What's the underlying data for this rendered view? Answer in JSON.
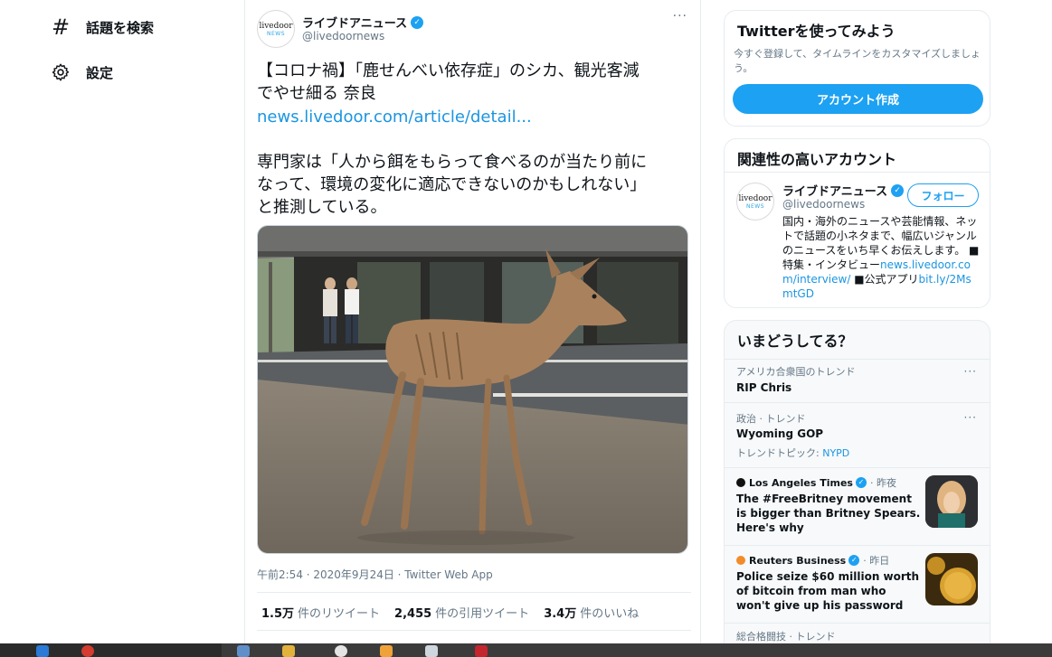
{
  "nav": {
    "explore_label": "話題を検索",
    "settings_label": "設定"
  },
  "tweet": {
    "author_name": "ライブドアニュース",
    "author_handle": "@livedoornews",
    "logo_text_top": "livedoor",
    "logo_text_bottom": "NEWS",
    "text1": "【コロナ禍】「鹿せんべい依存症」のシカ、観光客減\nでやせ細る 奈良",
    "link": "news.livedoor.com/article/detail...",
    "text2": "専門家は「人から餌をもらって食べるのが当たり前に\nなって、環境の変化に適応できないのかもしれない」\nと推測している。",
    "meta": "午前2:54 · 2020年9月24日 · Twitter Web App",
    "retweets_count": "1.5万",
    "retweets_label": "件のリツイート",
    "quotes_count": "2,455",
    "quotes_label": "件の引用ツイート",
    "likes_count": "3.4万",
    "likes_label": "件のいいね"
  },
  "signup": {
    "title": "Twitterを使ってみよう",
    "desc": "今すぐ登録して、タイムラインをカスタマイズしましょう。",
    "button": "アカウント作成"
  },
  "related": {
    "title": "関連性の高いアカウント",
    "name": "ライブドアニュース",
    "handle": "@livedoornews",
    "follow": "フォロー",
    "bio_text": "国内・海外のニュースや芸能情報、ネットで話題の小ネタまで、幅広いジャンルのニュースをいち早くお伝えします。 ■特集・インタビュー",
    "bio_link1": "news.livedoor.com/interview/",
    "bio_mid": " ■公式アプリ",
    "bio_link2": "bit.ly/2MsmtGD"
  },
  "trends": {
    "title": "いまどうしてる？",
    "items": [
      {
        "category": "アメリカ合衆国のトレンド",
        "title": "RIP Chris"
      },
      {
        "category": "政治 · トレンド",
        "title": "Wyoming GOP",
        "sub_label": "トレンドトピック:",
        "sub_link": "NYPD"
      },
      {
        "source": "Los Angeles Times",
        "time": "· 昨夜",
        "title": "The #FreeBritney movement is bigger than Britney Spears. Here's why"
      },
      {
        "source": "Reuters Business",
        "time": "· 昨日",
        "title": "Police seize $60 million worth of bitcoin from man who won't give up his password"
      },
      {
        "category": "総合格闘技 · トレンド"
      }
    ]
  },
  "colors": {
    "accent": "#1da1f2",
    "link": "#1b95e0",
    "border": "#e6ecf0",
    "muted": "#657786"
  },
  "icons": {
    "explore": "hash-icon",
    "settings": "gear-icon",
    "verified": "verified-badge-icon",
    "more": "more-dots-icon"
  }
}
